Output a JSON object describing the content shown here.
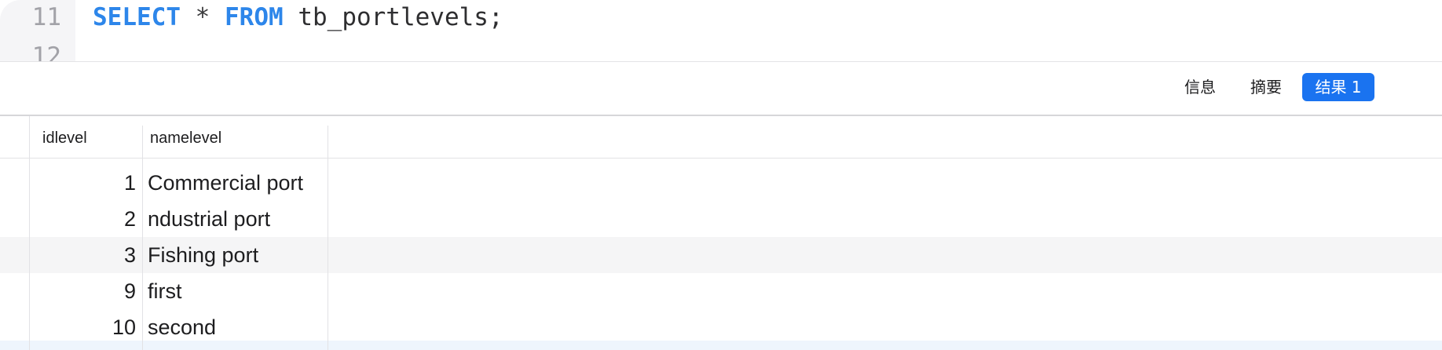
{
  "editor": {
    "lines": [
      {
        "number": "11",
        "keyword_select": "SELECT",
        "star": "*",
        "keyword_from": "FROM",
        "rest": "tb_portlevels;"
      },
      {
        "number": "12"
      }
    ]
  },
  "result_tabs": {
    "info": "信息",
    "summary": "摘要",
    "result": "结果 1",
    "active": "result",
    "active_color": "#1a73f0"
  },
  "grid": {
    "columns": [
      "idlevel",
      "namelevel"
    ],
    "rows": [
      {
        "idlevel": "1",
        "namelevel": "Commercial port"
      },
      {
        "idlevel": "2",
        "namelevel": "ndustrial port"
      },
      {
        "idlevel": "3",
        "namelevel": "Fishing port"
      },
      {
        "idlevel": "9",
        "namelevel": "first"
      },
      {
        "idlevel": "10",
        "namelevel": "second"
      }
    ]
  },
  "colors": {
    "keyword": "#2d86ea",
    "stripe": "#f5f5f6",
    "selected_row": "#eef5fd"
  }
}
